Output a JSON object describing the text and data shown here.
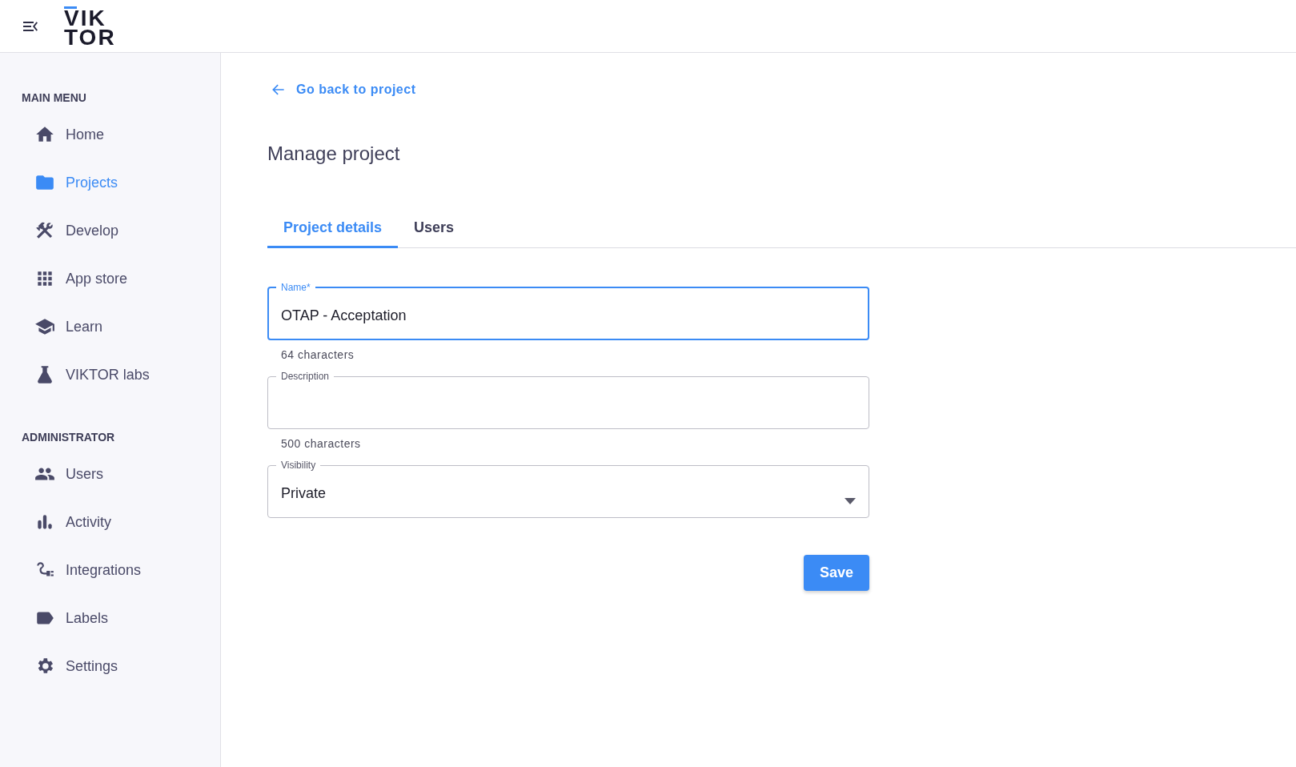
{
  "header": {
    "logo": [
      "VIK",
      "TOR"
    ]
  },
  "sidebar": {
    "sections": [
      {
        "title": "MAIN MENU",
        "items": [
          {
            "label": "Home",
            "selected": false
          },
          {
            "label": "Projects",
            "selected": true
          },
          {
            "label": "Develop",
            "selected": false
          },
          {
            "label": "App store",
            "selected": false
          },
          {
            "label": "Learn",
            "selected": false
          },
          {
            "label": "VIKTOR labs",
            "selected": false
          }
        ]
      },
      {
        "title": "ADMINISTRATOR",
        "items": [
          {
            "label": "Users",
            "selected": false
          },
          {
            "label": "Activity",
            "selected": false
          },
          {
            "label": "Integrations",
            "selected": false
          },
          {
            "label": "Labels",
            "selected": false
          },
          {
            "label": "Settings",
            "selected": false
          }
        ]
      }
    ]
  },
  "back_link": "Go back to project",
  "title": "Manage project",
  "tabs": [
    {
      "label": "Project details",
      "selected": true
    },
    {
      "label": "Users",
      "selected": false
    }
  ],
  "fields": [
    {
      "kind": "text",
      "label": "Name*",
      "value": "OTAP - Acceptation",
      "focused": true,
      "helper": "64 characters"
    },
    {
      "kind": "textarea",
      "label": "Description",
      "focused": false,
      "helper": "500 characters"
    },
    {
      "kind": "select",
      "label": "Visibility",
      "value": "Private",
      "focused": false
    }
  ],
  "save_button": "Save"
}
